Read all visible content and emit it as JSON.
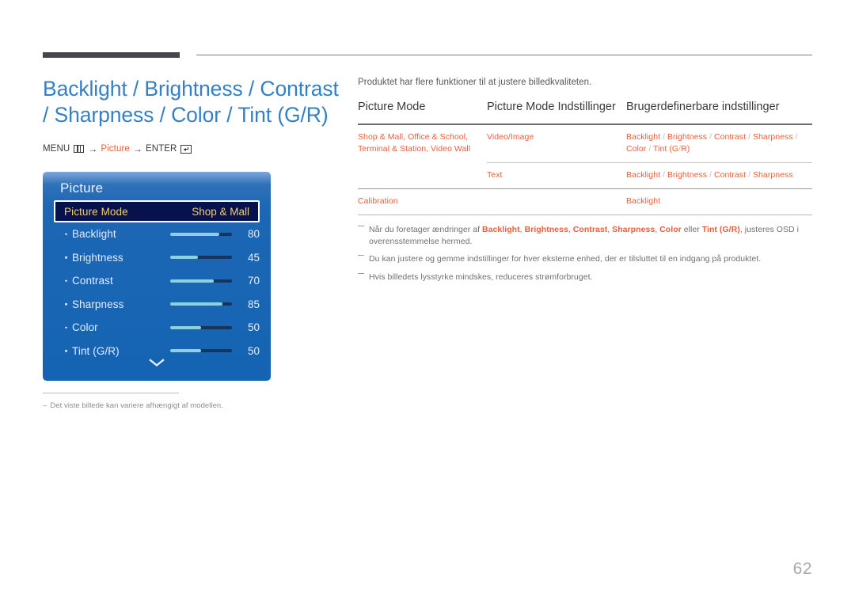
{
  "header": {
    "rule_color": "#46464f"
  },
  "left": {
    "page_title_line1": "Backlight / Brightness / Contrast",
    "page_title_line2": "/ Sharpness / Color / Tint (G/R)",
    "menu_path": {
      "menu_label": "MENU",
      "menu_icon": "menu-grid-icon",
      "arrow1": "→",
      "picture_label": "Picture",
      "arrow2": "→",
      "enter_label": "ENTER",
      "enter_icon": "enter-key-icon"
    },
    "note_dash": "–",
    "note_text": "Det viste billede kan variere afhængigt af modellen."
  },
  "osd": {
    "title": "Picture",
    "selected_row": {
      "label": "Picture Mode",
      "value": "Shop & Mall"
    },
    "items": [
      {
        "label": "Backlight",
        "value": "80",
        "percent": 80
      },
      {
        "label": "Brightness",
        "value": "45",
        "percent": 45
      },
      {
        "label": "Contrast",
        "value": "70",
        "percent": 70
      },
      {
        "label": "Sharpness",
        "value": "85",
        "percent": 85
      },
      {
        "label": "Color",
        "value": "50",
        "percent": 50
      },
      {
        "label": "Tint (G/R)",
        "value": "50",
        "percent": 50
      }
    ],
    "scroll_down_icon": "chevron-down-icon",
    "accent_highlight": "#07114b",
    "accent_text": "#f3cf6a",
    "slider_fill": "#8fd0dd",
    "slider_track": "#15355c"
  },
  "right": {
    "intro": "Produktet har flere funktioner til at justere billedkvaliteten.",
    "table": {
      "headers": [
        "Picture Mode",
        "Picture Mode Indstillinger",
        "Brugerdefinerbare indstillinger"
      ],
      "rows": [
        {
          "col1": "Shop & Mall, Office & School, Terminal & Station, Video Wall",
          "col2": "Video/Image",
          "col3": "Backlight / Brightness / Contrast / Sharpness / Color / Tint (G/R)"
        },
        {
          "col1": "",
          "col2": "Text",
          "col3": "Backlight / Brightness / Contrast / Sharpness"
        },
        {
          "col1": "Calibration",
          "col2": "",
          "col3": "Backlight"
        }
      ]
    },
    "notes": [
      "Når du foretager ændringer af Backlight, Brightness, Contrast, Sharpness, Color eller Tint (G/R), justeres OSD i overensstemmelse hermed.",
      "Du kan justere og gemme indstillinger for hver eksterne enhed, der er tilsluttet til en indgang på produktet.",
      "Hvis billedets lysstyrke mindskes, reduceres strømforbruget."
    ]
  },
  "page_number": "62",
  "colors": {
    "title_blue": "#3480c4",
    "accent_orange": "#e2603c",
    "body_gray": "#58585b"
  }
}
